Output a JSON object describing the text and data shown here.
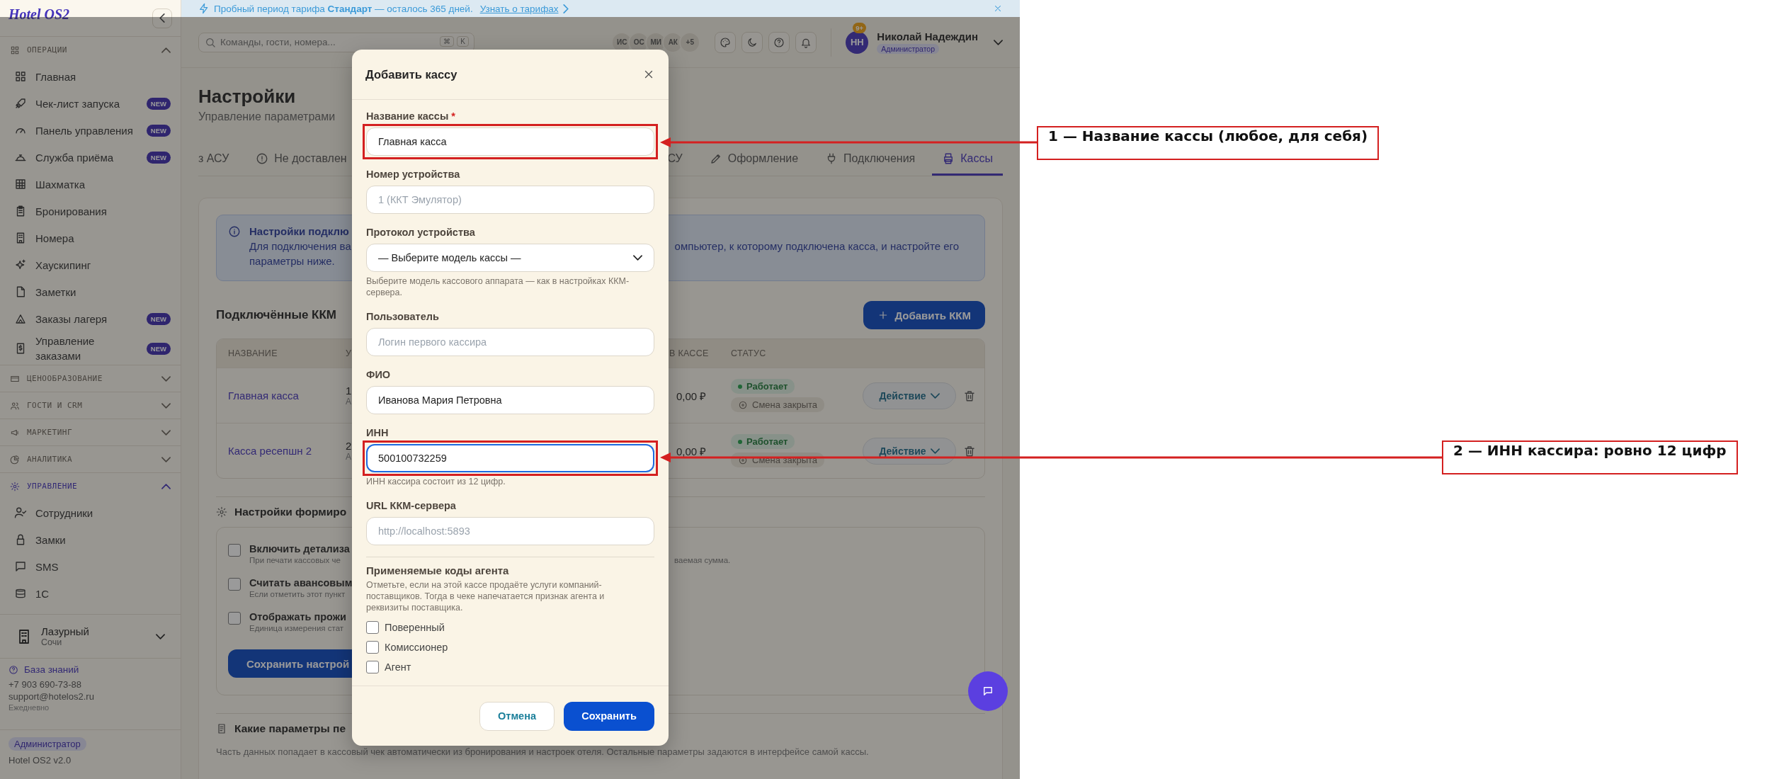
{
  "banner": {
    "text": "Пробный период тарифа **Стандарт** — осталось 365 дней.",
    "link": "Узнать о тарифах"
  },
  "sidebar": {
    "logo": "Hotel OS2",
    "sections": [
      {
        "title": "ОПЕРАЦИИ",
        "expanded": true,
        "selected": false,
        "items": [
          {
            "label": "Главная"
          },
          {
            "label": "Чек-лист запуска",
            "badge": "NEW"
          },
          {
            "label": "Панель управления",
            "badge": "NEW"
          },
          {
            "label": "Служба приёма",
            "badge": "NEW"
          },
          {
            "label": "Шахматка"
          },
          {
            "label": "Бронирования"
          },
          {
            "label": "Номера"
          },
          {
            "label": "Хаускипинг"
          },
          {
            "label": "Заметки"
          },
          {
            "label": "Заказы лагеря",
            "badge": "NEW"
          },
          {
            "label": "Управление заказами",
            "badge": "NEW"
          }
        ]
      },
      {
        "title": "ЦЕНООБРАЗОВАНИЕ",
        "expanded": false,
        "selected": false
      },
      {
        "title": "ГОСТИ И CRM",
        "expanded": false,
        "selected": false
      },
      {
        "title": "МАРКЕТИНГ",
        "expanded": false,
        "selected": false
      },
      {
        "title": "АНАЛИТИКА",
        "expanded": false,
        "selected": false
      },
      {
        "title": "УПРАВЛЕНИЕ",
        "expanded": true,
        "selected": true,
        "items": [
          {
            "label": "Сотрудники"
          },
          {
            "label": "Замки"
          },
          {
            "label": "SMS"
          },
          {
            "label": "1С"
          }
        ]
      }
    ],
    "hotel": {
      "name": "Лазурный",
      "city": "Сочи"
    },
    "help_link": "База знаний",
    "phone": "+7 903 690-73-88",
    "email": "support@hotelos2.ru",
    "hours": "Ежедневно",
    "role": "Администратор",
    "version": "Hotel OS2 v2.0"
  },
  "topbar": {
    "search": {
      "placeholder": "Команды, гости, номера..."
    },
    "keys": [
      "⌘",
      "K"
    ],
    "avatars": [
      "ИС",
      "ОС",
      "МИ",
      "АК",
      "+5"
    ],
    "notifications": "9+",
    "user": {
      "initials": "НН",
      "name": "Николай Надеждин",
      "role": "Администратор"
    }
  },
  "page": {
    "title": "Настройки",
    "subtitle": "Управление параметрами",
    "tabs": [
      {
        "label": "з АСУ",
        "selected": false
      },
      {
        "label": "Не доставлен",
        "selected": false
      },
      {
        "label": "СУ",
        "selected": false
      },
      {
        "label": "Оформление",
        "selected": false
      },
      {
        "label": "Подключения",
        "selected": false
      },
      {
        "label": "Кассы",
        "selected": true
      }
    ],
    "info": {
      "title": "Настройки подклю",
      "text_left": "Для подключения ва",
      "text_right": "омпьютер, к которому подключена касса, и настройте его",
      "text_end": "параметры ниже."
    },
    "kkm": {
      "heading": "Подключённые ККМ",
      "add_button": "Добавить ККМ",
      "columns": [
        "НАЗВАНИЕ",
        "У",
        "В КАССЕ",
        "СТАТУС"
      ],
      "rows": [
        {
          "name": "Главная касса",
          "device": "1",
          "device_sub": "А",
          "cash": "0,00 ₽",
          "status": "Работает",
          "shift": "Смена закрыта",
          "action": "Действие"
        },
        {
          "name": "Касса ресепшн 2",
          "device": "2",
          "device_sub": "А",
          "cash": "0,00 ₽",
          "status": "Работает",
          "shift": "Смена закрыта",
          "action": "Действие"
        }
      ]
    },
    "fiscal": {
      "heading": "Настройки формиро",
      "options": [
        {
          "label": "Включить детализа",
          "hint": "При печати кассовых че",
          "hint_right": "ваемая сумма.",
          "checked": false
        },
        {
          "label": "Считать авансовым",
          "hint": "Если отметить этот пункт",
          "checked": false
        },
        {
          "label": "Отображать прожи",
          "hint": "Единица измерения стат",
          "checked": false
        }
      ],
      "save_button": "Сохранить настрой"
    },
    "receipt": {
      "heading": "Какие параметры пе",
      "text": "Часть данных попадает в кассовый чек автоматически из бронирования и настроек отеля. Остальные параметры задаются в интерфейсе самой кассы."
    }
  },
  "modal": {
    "title": "Добавить кассу",
    "fields": [
      {
        "kind": "text",
        "label": "Название кассы",
        "required_mark": "*",
        "value": "Главная касса",
        "focused": false,
        "highlighted": true
      },
      {
        "kind": "text",
        "label": "Номер устройства",
        "placeholder": "1 (ККТ Эмулятор)",
        "focused": false,
        "highlighted": false
      },
      {
        "kind": "select",
        "label": "Протокол устройства",
        "value": "— Выберите модель кассы —",
        "hint": "Выберите модель кассового аппарата — как в настройках ККМ-сервера.",
        "focused": false,
        "highlighted": false
      },
      {
        "kind": "text",
        "label": "Пользователь",
        "placeholder": "Логин первого кассира",
        "focused": false,
        "highlighted": false
      },
      {
        "kind": "text",
        "label": "ФИО",
        "value": "Иванова Мария Петровна",
        "focused": false,
        "highlighted": false
      },
      {
        "kind": "text",
        "label": "ИНН",
        "value": "500100732259",
        "hint": "ИНН кассира состоит из 12 цифр.",
        "focused": true,
        "highlighted": true
      },
      {
        "kind": "text",
        "label": "URL ККМ-сервера",
        "placeholder": "http://localhost:5893",
        "focused": false,
        "highlighted": false
      }
    ],
    "agent": {
      "title": "Применяемые коды агента",
      "text": "Отметьте, если на этой кассе продаёте услуги компаний-поставщиков. Тогда в чеке напечатается признак агента и реквизиты поставщика.",
      "options": [
        {
          "label": "Поверенный",
          "checked": false
        },
        {
          "label": "Комиссионер",
          "checked": false
        },
        {
          "label": "Агент",
          "checked": false
        }
      ]
    },
    "cancel_button": "Отмена",
    "save_button": "Сохранить"
  },
  "annotations": [
    {
      "text": "1 — Название кассы (любое, для себя)"
    },
    {
      "text": "2 — ИНН кассира: ровно 12 цифр"
    }
  ]
}
